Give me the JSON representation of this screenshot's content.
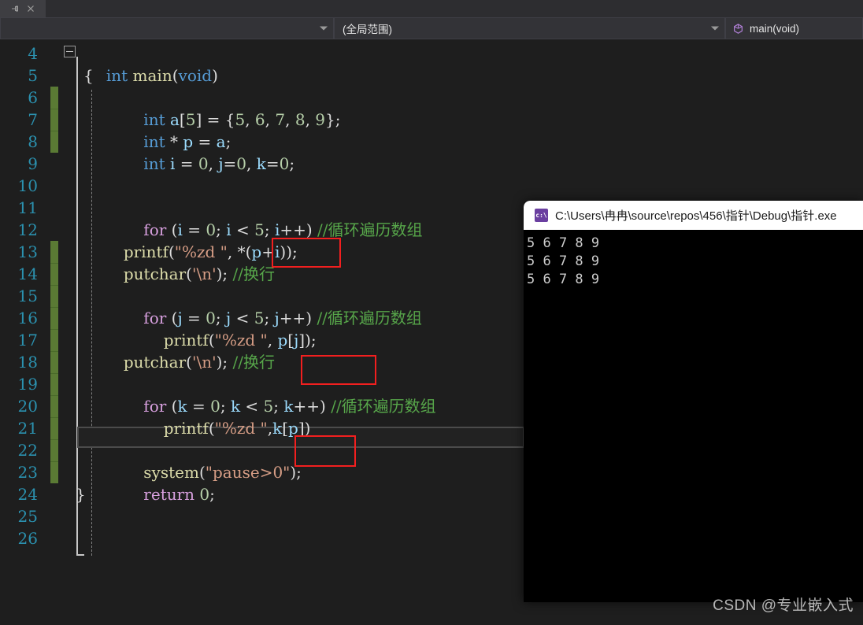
{
  "window": {
    "tab": {
      "pin_icon": "pin-icon",
      "close_icon": "close-icon"
    }
  },
  "navbar": {
    "scope_selector_value": "",
    "scope_selector_placeholder": "",
    "global_scope_value": "(全局范围)",
    "member_selector_value": "main(void)",
    "member_icon": "method-icon"
  },
  "editor": {
    "first_line_number": 4,
    "line_numbers": [
      4,
      5,
      6,
      7,
      8,
      9,
      10,
      11,
      12,
      13,
      14,
      15,
      16,
      17,
      18,
      19,
      20,
      21,
      22,
      23,
      24,
      25,
      26
    ],
    "current_line": 18,
    "change_bar_color": "#5a7a34",
    "lines": [
      {
        "n": 4,
        "text": "int main(void)"
      },
      {
        "n": 5,
        "text": "{"
      },
      {
        "n": 6,
        "text": "    int a[5] = {5, 6, 7, 8, 9};"
      },
      {
        "n": 7,
        "text": "    int * p = a;"
      },
      {
        "n": 8,
        "text": "    int i = 0, j=0, k=0;"
      },
      {
        "n": 9,
        "text": ""
      },
      {
        "n": 10,
        "text": ""
      },
      {
        "n": 11,
        "text": "    for (i = 0; i < 5; i++) //循环遍历数组"
      },
      {
        "n": 12,
        "text": "printf(\"%zd \", *(p+i));"
      },
      {
        "n": 13,
        "text": "putchar('\\n'); //换行"
      },
      {
        "n": 14,
        "text": ""
      },
      {
        "n": 15,
        "text": "    for (j = 0; j < 5; j++) //循环遍历数组"
      },
      {
        "n": 16,
        "text": "        printf(\"%zd \", p[j]);"
      },
      {
        "n": 17,
        "text": "putchar('\\n'); //换行"
      },
      {
        "n": 18,
        "text": ""
      },
      {
        "n": 19,
        "text": "    for (k = 0; k < 5; k++) //循环遍历数组"
      },
      {
        "n": 20,
        "text": "        printf(\"%zd \",k[p])"
      },
      {
        "n": 21,
        "text": ""
      },
      {
        "n": 22,
        "text": "    system(\"pause>0\");"
      },
      {
        "n": 23,
        "text": "    return 0;"
      },
      {
        "n": 24,
        "text": "}"
      },
      {
        "n": 25,
        "text": ""
      },
      {
        "n": 26,
        "text": ""
      }
    ],
    "annotations": [
      {
        "id": "redbox-1",
        "target": "*(p+i))",
        "line": 12,
        "color": "#f21f1f"
      },
      {
        "id": "redbox-2",
        "target": "p[j]);",
        "line": 16,
        "color": "#f21f1f"
      },
      {
        "id": "redbox-3",
        "target": "k[p])",
        "line": 20,
        "color": "#f21f1f"
      }
    ]
  },
  "console": {
    "icon": "cmd-icon",
    "icon_text": "c:\\",
    "title": "C:\\Users\\冉冉\\source\\repos\\456\\指针\\Debug\\指针.exe",
    "output": [
      "5 6 7 8 9",
      "5 6 7 8 9",
      "5 6 7 8 9"
    ]
  },
  "watermark": {
    "text": "CSDN @专业嵌入式"
  }
}
